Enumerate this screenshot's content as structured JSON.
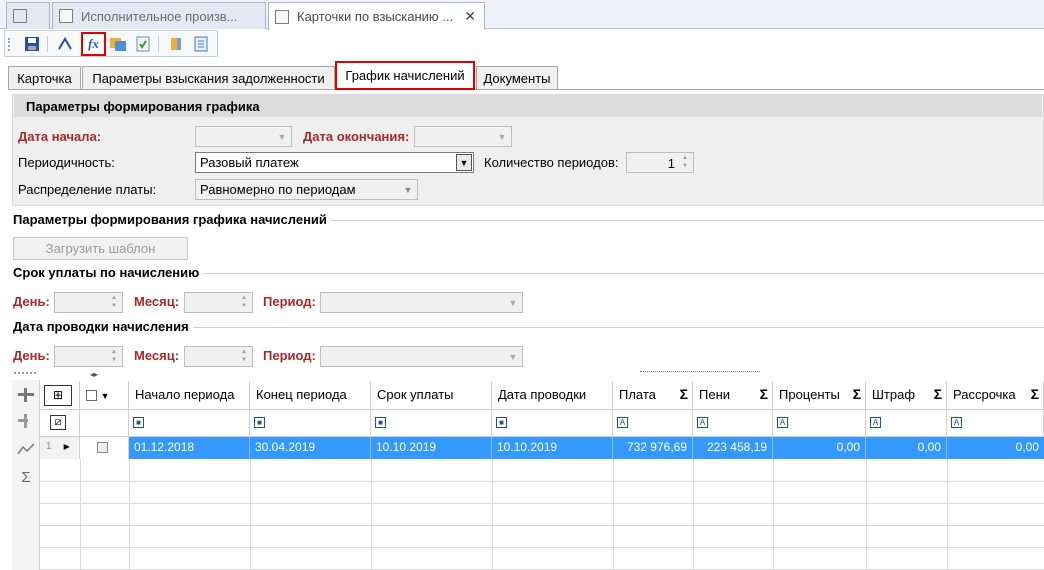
{
  "doc_tabs": [
    {
      "label": ""
    },
    {
      "label": "Исполнительное произв..."
    },
    {
      "label": "Карточки по взысканию ...",
      "close": "✕"
    }
  ],
  "toolbar": {
    "icons": [
      "save-icon",
      "edit-icon",
      "formula-icon",
      "copy-icon",
      "refresh-icon",
      "book-icon",
      "list-icon"
    ],
    "formula_glyph": "fx"
  },
  "section_tabs": [
    "Карточка",
    "Параметры взыскания задолженности",
    "График начислений",
    "Документы"
  ],
  "params": {
    "title": "Параметры формирования графика",
    "start_date_label": "Дата начала:",
    "end_date_label": "Дата окончания:",
    "periodicity_label": "Периодичность:",
    "periodicity_value": "Разовый платеж",
    "periods_count_label": "Количество периодов:",
    "periods_count_value": "1",
    "distribution_label": "Распределение платы:",
    "distribution_value": "Равномерно по периодам"
  },
  "accrual_section": {
    "title": "Параметры формирования графика начислений",
    "load_template_button": "Загрузить шаблон"
  },
  "payment_due": {
    "title": "Срок уплаты по начислению",
    "day_label": "День:",
    "month_label": "Месяц:",
    "period_label": "Период:"
  },
  "posting_date": {
    "title": "Дата проводки начисления",
    "day_label": "День:",
    "month_label": "Месяц:",
    "period_label": "Период:"
  },
  "grid": {
    "columns": [
      "Начало периода",
      "Конец периода",
      "Срок уплаты",
      "Дата проводки",
      "Плата",
      "Пени",
      "Проценты",
      "Штраф",
      "Рассрочка"
    ],
    "sum_glyph": "Σ",
    "rows": [
      {
        "num": "1",
        "period_start": "01.12.2018",
        "period_end": "30.04.2019",
        "due_date": "10.10.2019",
        "posting_date": "10.10.2019",
        "payment": "732 976,69",
        "penalty": "223 458,19",
        "interest": "0,00",
        "fine": "0,00",
        "installment": "0,00"
      }
    ]
  }
}
